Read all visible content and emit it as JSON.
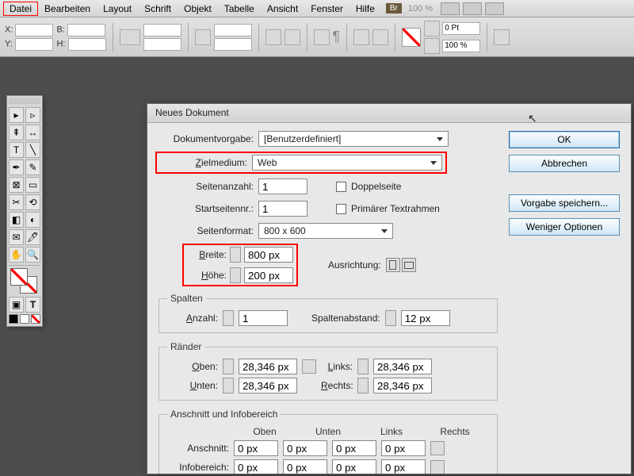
{
  "menu": {
    "items": [
      "Datei",
      "Bearbeiten",
      "Layout",
      "Schrift",
      "Objekt",
      "Tabelle",
      "Ansicht",
      "Fenster",
      "Hilfe"
    ],
    "br": "Br",
    "zoom": "100 %"
  },
  "ctrl": {
    "x": "X:",
    "y": "Y:",
    "b": "B:",
    "h": "H:",
    "pt": "0 Pt",
    "pct": "100 %"
  },
  "dialog": {
    "title": "Neues Dokument",
    "labels": {
      "preset": "Dokumentvorgabe:",
      "intent": "Zielmedium:",
      "pages": "Seitenanzahl:",
      "start": "Startseitennr.:",
      "facing": "Doppelseite",
      "primary": "Primärer Textrahmen",
      "pagesize": "Seitenformat:",
      "width": "Breite:",
      "height": "Höhe:",
      "orient": "Ausrichtung:",
      "columns": "Spalten",
      "count": "Anzahl:",
      "gutter": "Spaltenabstand:",
      "margins": "Ränder",
      "top": "Oben:",
      "bottom": "Unten:",
      "left": "Links:",
      "right": "Rechts:",
      "bleed": "Anschnitt und Infobereich",
      "bleedrow": "Anschnitt:",
      "slugrow": "Infobereich:",
      "col_top": "Oben",
      "col_bottom": "Unten",
      "col_left": "Links",
      "col_right": "Rechts"
    },
    "values": {
      "preset": "[Benutzerdefiniert]",
      "intent": "Web",
      "pages": "1",
      "start": "1",
      "pagesize": "800 x 600",
      "width": "800 px",
      "height": "200 px",
      "count": "1",
      "gutter": "12 px",
      "top": "28,346 px",
      "bottom": "28,346 px",
      "left": "28,346 px",
      "right": "28,346 px",
      "bleed": "0 px",
      "slug": "0 px"
    },
    "buttons": {
      "ok": "OK",
      "cancel": "Abbrechen",
      "save": "Vorgabe speichern...",
      "fewer": "Weniger Optionen"
    }
  }
}
